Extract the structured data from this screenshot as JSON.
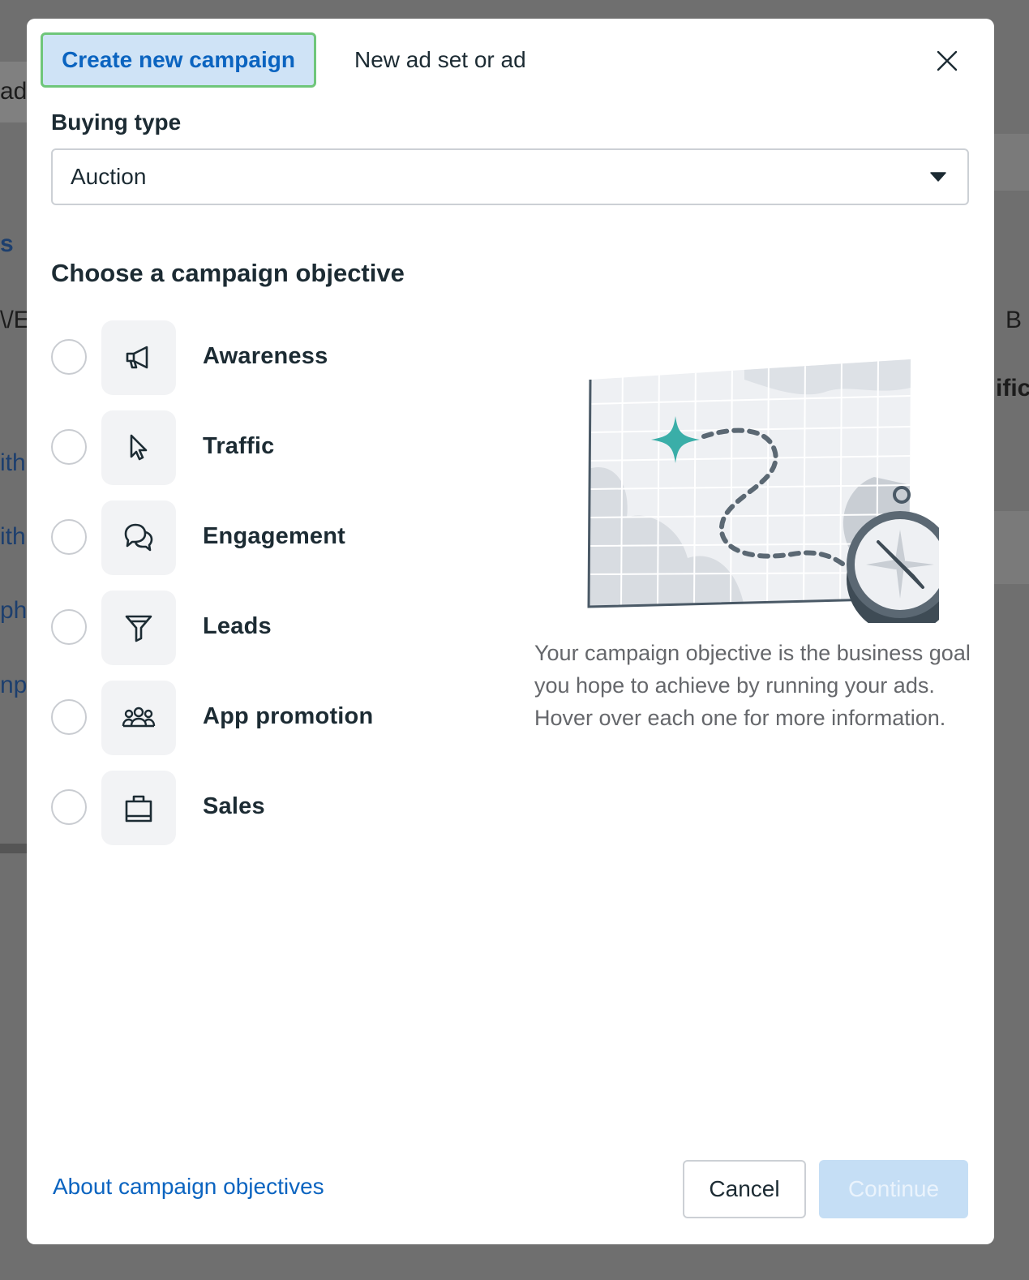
{
  "tabs": {
    "create_new_campaign": "Create new campaign",
    "new_ad_set_or_ad": "New ad set or ad"
  },
  "icons": {
    "close": "close-icon",
    "dropdown": "caret-down-icon"
  },
  "buying_type": {
    "label": "Buying type",
    "selected": "Auction"
  },
  "objective_section": {
    "title": "Choose a campaign objective",
    "options": [
      {
        "label": "Awareness",
        "icon": "megaphone-icon",
        "selected": false
      },
      {
        "label": "Traffic",
        "icon": "cursor-icon",
        "selected": false
      },
      {
        "label": "Engagement",
        "icon": "chat-bubbles-icon",
        "selected": false
      },
      {
        "label": "Leads",
        "icon": "funnel-icon",
        "selected": false
      },
      {
        "label": "App promotion",
        "icon": "people-group-icon",
        "selected": false
      },
      {
        "label": "Sales",
        "icon": "shopping-bag-icon",
        "selected": false
      }
    ]
  },
  "description": "Your campaign objective is the business goal you hope to achieve by running your ads. Hover over each one for more information.",
  "footer": {
    "about_link": "About campaign objectives",
    "cancel": "Cancel",
    "continue": "Continue",
    "continue_enabled": false
  },
  "background_fragments": [
    "ad:",
    "s",
    "\\/E",
    "ith",
    "ith",
    "ph",
    "nph",
    "B",
    "ific"
  ],
  "colors": {
    "accent_blue": "#0b64c0",
    "active_tab_bg": "#cfe3f6",
    "active_tab_border": "#6fc67a",
    "map_star_teal": "#3aaea8",
    "continue_disabled_bg": "#c5def5"
  }
}
